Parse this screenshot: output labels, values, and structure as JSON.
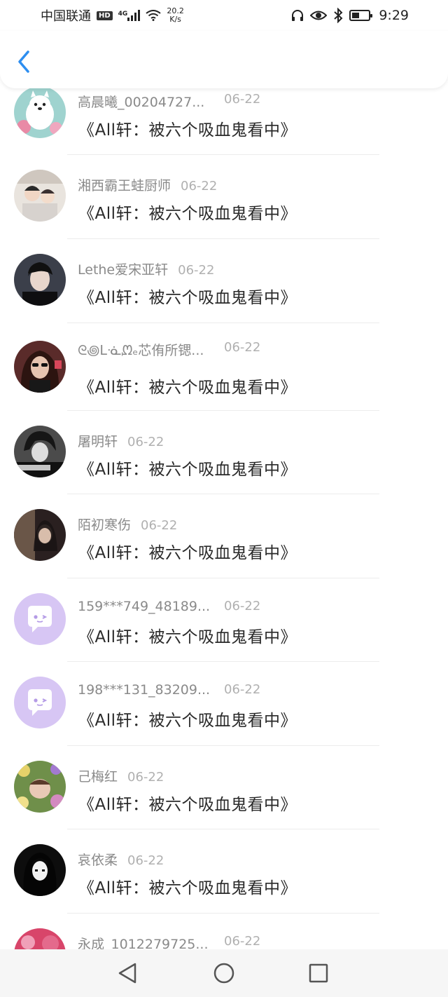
{
  "status_bar": {
    "carrier": "中国联通",
    "hd": "HD",
    "network": "4G",
    "speed_value": "20.2",
    "speed_unit": "K/s",
    "time": "9:29",
    "battery_fraction": 0.45
  },
  "header": {
    "back_icon": "chevron-left-icon",
    "accent_color": "#2d8ef0"
  },
  "items": [
    {
      "name": "高晨曦_00204727...",
      "date": "06-22",
      "title": "《All轩：被六个吸血鬼看中》",
      "avatar": "samoyed"
    },
    {
      "name": "湘西霸王蛙厨师",
      "date": "06-22",
      "title": "《All轩：被六个吸血鬼看中》",
      "avatar": "boys"
    },
    {
      "name": "Lethe爱宋亚轩",
      "date": "06-22",
      "title": "《All轩：被六个吸血鬼看中》",
      "avatar": "dark-boy"
    },
    {
      "name": "ᘓ꩜ᒪᓍᘻₑ芯侑所锶...",
      "date": "06-22",
      "title": "《All轩：被六个吸血鬼看中》",
      "avatar": "girl-glasses"
    },
    {
      "name": "屠明轩",
      "date": "06-22",
      "title": "《All轩：被六个吸血鬼看中》",
      "avatar": "anime-boy"
    },
    {
      "name": "陌初寒伤",
      "date": "06-22",
      "title": "《All轩：被六个吸血鬼看中》",
      "avatar": "dark-girl"
    },
    {
      "name": "159***749_48189...",
      "date": "06-22",
      "title": "《All轩：被六个吸血鬼看中》",
      "avatar": "default"
    },
    {
      "name": "198***131_83209...",
      "date": "06-22",
      "title": "《All轩：被六个吸血鬼看中》",
      "avatar": "default"
    },
    {
      "name": "己梅红",
      "date": "06-22",
      "title": "《All轩：被六个吸血鬼看中》",
      "avatar": "flowers"
    },
    {
      "name": "哀依柔",
      "date": "06-22",
      "title": "《All轩：被六个吸血鬼看中》",
      "avatar": "bw-girl"
    },
    {
      "name": "永成_1012279725...",
      "date": "06-22",
      "title": "",
      "avatar": "pink"
    }
  ]
}
